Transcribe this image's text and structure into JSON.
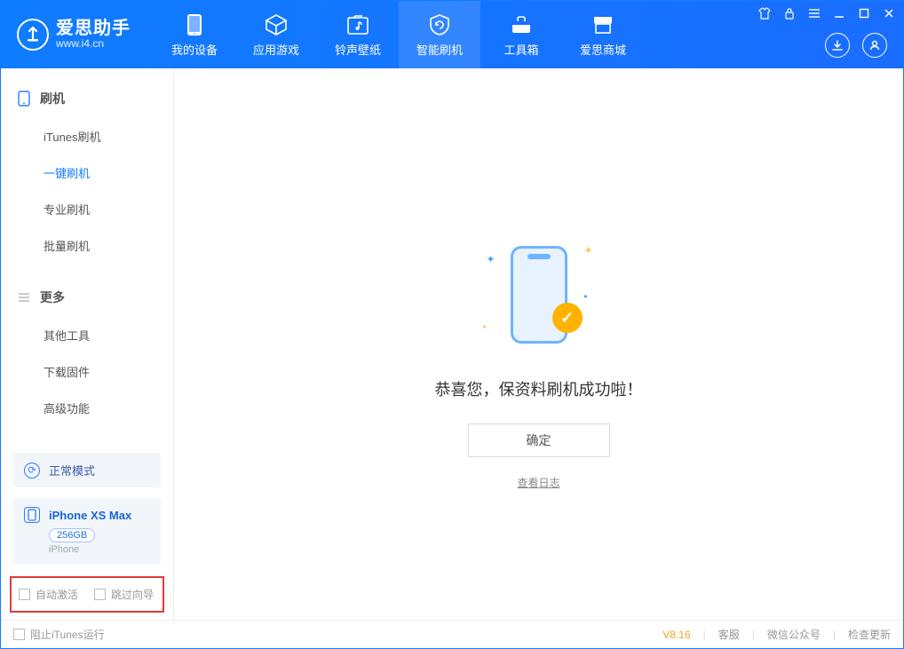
{
  "app": {
    "title": "爱思助手",
    "url": "www.i4.cn"
  },
  "nav": {
    "tabs": [
      {
        "label": "我的设备"
      },
      {
        "label": "应用游戏"
      },
      {
        "label": "铃声壁纸"
      },
      {
        "label": "智能刷机"
      },
      {
        "label": "工具箱"
      },
      {
        "label": "爱思商城"
      }
    ]
  },
  "sidebar": {
    "section1": {
      "title": "刷机",
      "items": [
        {
          "label": "iTunes刷机"
        },
        {
          "label": "一键刷机"
        },
        {
          "label": "专业刷机"
        },
        {
          "label": "批量刷机"
        }
      ]
    },
    "section2": {
      "title": "更多",
      "items": [
        {
          "label": "其他工具"
        },
        {
          "label": "下载固件"
        },
        {
          "label": "高级功能"
        }
      ]
    },
    "mode": {
      "label": "正常模式"
    },
    "device": {
      "name": "iPhone XS Max",
      "storage": "256GB",
      "type": "iPhone"
    },
    "checks": {
      "auto_activate": "自动激活",
      "skip_guide": "跳过向导"
    }
  },
  "main": {
    "success_message": "恭喜您，保资料刷机成功啦！",
    "ok_button": "确定",
    "view_log": "查看日志"
  },
  "footer": {
    "stop_itunes": "阻止iTunes运行",
    "version": "V8.16",
    "links": {
      "support": "客服",
      "wechat": "微信公众号",
      "update": "检查更新"
    }
  }
}
